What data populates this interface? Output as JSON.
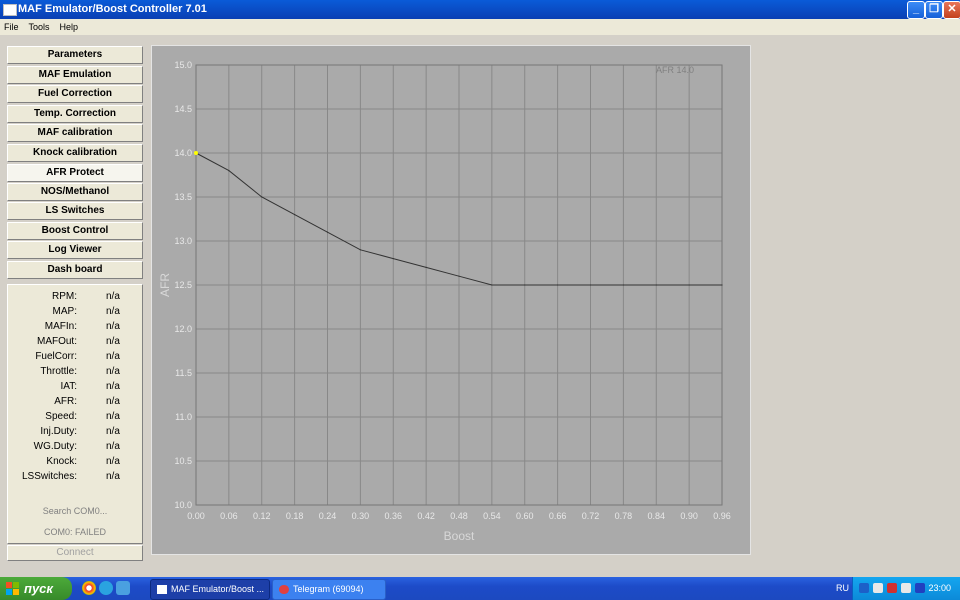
{
  "window": {
    "title": "MAF Emulator/Boost Controller 7.01",
    "controls": {
      "minimize": "_",
      "maximize": "❐",
      "close": "✕"
    }
  },
  "menu": [
    "File",
    "Tools",
    "Help"
  ],
  "nav": {
    "items": [
      "Parameters",
      "MAF Emulation",
      "Fuel Correction",
      "Temp. Correction",
      "MAF calibration",
      "Knock calibration",
      "AFR Protect",
      "NOS/Methanol",
      "LS Switches",
      "Boost Control",
      "Log Viewer",
      "Dash board"
    ],
    "active": "AFR Protect"
  },
  "sensors": [
    {
      "label": "RPM:",
      "value": "n/a"
    },
    {
      "label": "MAP:",
      "value": "n/a"
    },
    {
      "label": "MAFIn:",
      "value": "n/a"
    },
    {
      "label": "MAFOut:",
      "value": "n/a"
    },
    {
      "label": "FuelCorr:",
      "value": "n/a"
    },
    {
      "label": "Throttle:",
      "value": "n/a"
    },
    {
      "label": "IAT:",
      "value": "n/a"
    },
    {
      "label": "AFR:",
      "value": "n/a"
    },
    {
      "label": "Speed:",
      "value": "n/a"
    },
    {
      "label": "Inj.Duty:",
      "value": "n/a"
    },
    {
      "label": "WG.Duty:",
      "value": "n/a"
    },
    {
      "label": "Knock:",
      "value": "n/a"
    },
    {
      "label": "LSSwitches:",
      "value": "n/a"
    }
  ],
  "status": {
    "search": "Search COM0...",
    "com": "COM0: FAILED",
    "connect_label": "Connect"
  },
  "chart_data": {
    "type": "line",
    "xlabel": "Boost",
    "ylabel": "AFR",
    "annotation": "AFR 14.0",
    "xlim": [
      0,
      0.96
    ],
    "ylim": [
      10.0,
      15.0
    ],
    "grid": true,
    "x_ticks": [
      "0.00",
      "0.06",
      "0.12",
      "0.18",
      "0.24",
      "0.30",
      "0.36",
      "0.42",
      "0.48",
      "0.54",
      "0.60",
      "0.66",
      "0.72",
      "0.78",
      "0.84",
      "0.90",
      "0.96"
    ],
    "y_ticks": [
      "10.0",
      "10.5",
      "11.0",
      "11.5",
      "12.0",
      "12.5",
      "13.0",
      "13.5",
      "14.0",
      "14.5",
      "15.0"
    ],
    "series": [
      {
        "x": [
          0.0,
          0.06,
          0.12,
          0.18,
          0.24,
          0.3,
          0.36,
          0.42,
          0.48,
          0.54,
          0.6,
          0.66,
          0.72,
          0.78,
          0.84,
          0.9,
          0.96
        ],
        "y": [
          14.0,
          13.8,
          13.5,
          13.3,
          13.1,
          12.9,
          12.8,
          12.7,
          12.6,
          12.5,
          12.5,
          12.5,
          12.5,
          12.5,
          12.5,
          12.5,
          12.5
        ]
      }
    ],
    "highlight_point": {
      "x": 0.0,
      "y": 14.0,
      "color": "#ffff00"
    }
  },
  "taskbar": {
    "start_label": "пуск",
    "tasks": [
      "MAF Emulator/Boost ...",
      "Telegram (69094)"
    ],
    "language": "RU",
    "clock": "23:00"
  },
  "colors": {
    "chart_bg": "#aaaaaa",
    "grid": "#888888",
    "line": "#333333",
    "axis_text": "#e8e8e8"
  }
}
